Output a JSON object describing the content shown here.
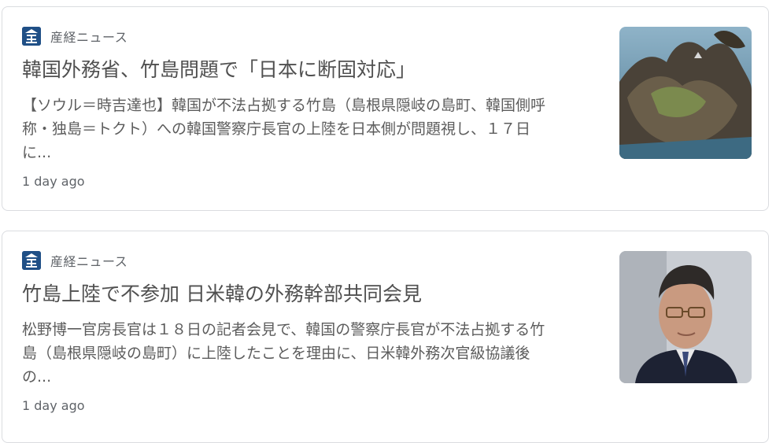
{
  "cards": [
    {
      "source": "産経ニュース",
      "source_logo_icon": "sankei-logo-icon",
      "headline": "韓国外務省、竹島問題で「日本に断固対応」",
      "snippet_lines": [
        "【ソウル＝時吉達也】韓国が不法占拠する竹島（島根県隠岐の島町、韓国側呼",
        "称・独島＝トクト）への韓国警察庁長官の上陸を日本側が問題視し、１７日",
        "に..."
      ],
      "time": "1 day ago",
      "thumbnail_icon": "island-photo-icon"
    },
    {
      "source": "産経ニュース",
      "source_logo_icon": "sankei-logo-icon",
      "headline": "竹島上陸で不参加 日米韓の外務幹部共同会見",
      "snippet_lines": [
        "松野博一官房長官は１８日の記者会見で、韓国の警察庁長官が不法占拠する竹",
        "島（島根県隠岐の島町）に上陸したことを理由に、日米韓外務次官級協議後",
        "の..."
      ],
      "time": "1 day ago",
      "thumbnail_icon": "portrait-photo-icon"
    }
  ],
  "colors": {
    "border": "#dadce0",
    "headline": "#505050",
    "snippet": "#5c5c5c",
    "meta": "#5f6368",
    "logo": "#1f4f86"
  }
}
